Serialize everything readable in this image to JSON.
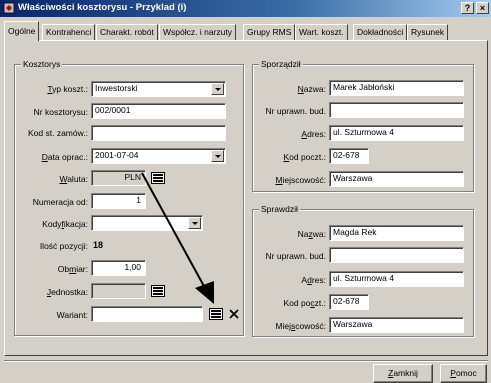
{
  "window": {
    "title": "Właściwości kosztorysu - Przyklad (i)",
    "help_btn": "?",
    "close_btn": "×"
  },
  "tabs": [
    {
      "label": "Ogólne"
    },
    {
      "label": "Kontrahenci"
    },
    {
      "label": "Charakt. robót"
    },
    {
      "label": "Współcz. i narzuty"
    },
    {
      "label": "Grupy RMS"
    },
    {
      "label": "Wart. koszt."
    },
    {
      "label": "Dokładności"
    },
    {
      "label": "Rysunek"
    }
  ],
  "kosztorys": {
    "group_title": "Kosztorys",
    "typ_label": "Typ koszt.:",
    "typ_value": "Inwestorski",
    "nr_label": "Nr kosztorysu:",
    "nr_value": "002/0001",
    "kod_label": "Kod st. zamów.:",
    "kod_value": "",
    "data_label": "Data oprac.:",
    "data_value": "2001-07-04",
    "waluta_label": "Waluta:",
    "waluta_value": "PLN",
    "numeracja_label": "Numeracja od:",
    "numeracja_value": "1",
    "kodyfikacja_label": "Kodyfikacja:",
    "kodyfikacja_value": "",
    "ilosc_label": "Ilość pozycji:",
    "ilosc_value": "18",
    "obmiar_label": "Obmiar:",
    "obmiar_value": "1,00",
    "jednostka_label": "Jednostka:",
    "jednostka_value": "",
    "wariant_label": "Wariant:",
    "wariant_value": ""
  },
  "sporzadzil": {
    "group_title": "Sporządził",
    "nazwa_label": "Nazwa:",
    "nazwa_value": "Marek Jabłoński",
    "nr_label": "Nr uprawn. bud.",
    "nr_value": "",
    "adres_label": "Adres:",
    "adres_value": "ul. Szturmowa 4",
    "kod_label": "Kod poczt.:",
    "kod_value": "02-678",
    "miejsc_label": "Miejscowość:",
    "miejsc_value": "Warszawa"
  },
  "sprawdzil": {
    "group_title": "Sprawdził",
    "nazwa_label": "Nazwa:",
    "nazwa_value": "Magda Rek",
    "nr_label": "Nr uprawn. bud.",
    "nr_value": "",
    "adres_label": "Adres:",
    "adres_value": "ul. Szturmowa 4",
    "kod_label": "Kod poczt.:",
    "kod_value": "02-678",
    "miejsc_label": "Miejscowość:",
    "miejsc_value": "Warszawa"
  },
  "footer": {
    "close_label": "Zamknij",
    "help_label": "Pomoc"
  }
}
